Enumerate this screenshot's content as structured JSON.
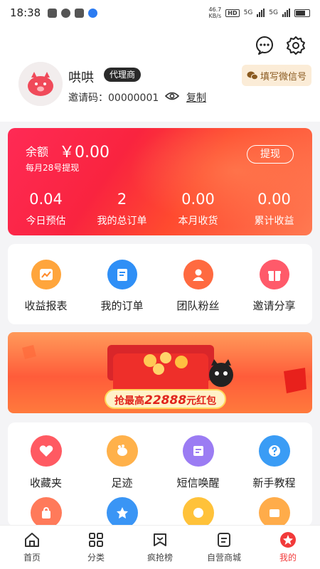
{
  "status_bar": {
    "time": "18:38",
    "speed_value": "46.7",
    "speed_unit": "KB/s",
    "hd": "HD",
    "net1": "5G",
    "net2": "5G"
  },
  "profile": {
    "username": "哄哄",
    "role": "代理商",
    "invite_label": "邀请码：00000001",
    "copy_label": "复制",
    "wechat_button": "填写微信号"
  },
  "balance": {
    "label": "余额",
    "amount": "￥0.00",
    "note": "每月28号提现",
    "withdraw_label": "提现",
    "stats": [
      {
        "value": "0.04",
        "label": "今日预估"
      },
      {
        "value": "2",
        "label": "我的总订单"
      },
      {
        "value": "0.00",
        "label": "本月收货"
      },
      {
        "value": "0.00",
        "label": "累计收益"
      }
    ]
  },
  "quick_actions": [
    {
      "label": "收益报表",
      "icon": "chart-report-icon",
      "color": "#ff9a3c"
    },
    {
      "label": "我的订单",
      "icon": "order-list-icon",
      "color": "#2f8ff6"
    },
    {
      "label": "团队粉丝",
      "icon": "team-user-icon",
      "color": "#ff6a40"
    },
    {
      "label": "邀请分享",
      "icon": "gift-icon",
      "color": "#ff5a6a"
    }
  ],
  "banner": {
    "prefix": "抢最高",
    "amount": "22888",
    "suffix": "元红包"
  },
  "tools": [
    {
      "label": "收藏夹",
      "icon": "heart-icon",
      "color": "#ff5a62"
    },
    {
      "label": "足迹",
      "icon": "footprint-icon",
      "color": "#ffb14a"
    },
    {
      "label": "短信唤醒",
      "icon": "sms-icon",
      "color": "#9b7cf3"
    },
    {
      "label": "新手教程",
      "icon": "help-icon",
      "color": "#3a9cf5"
    },
    {
      "label": "",
      "icon": "bag-icon",
      "color": "#ff7a5a"
    },
    {
      "label": "",
      "icon": "star-icon",
      "color": "#3a95f5"
    },
    {
      "label": "",
      "icon": "coin-icon",
      "color": "#ffc23a"
    },
    {
      "label": "",
      "icon": "ticket-icon",
      "color": "#ffac4a"
    }
  ],
  "tabbar": [
    {
      "label": "首页",
      "icon": "home-icon",
      "active": false
    },
    {
      "label": "分类",
      "icon": "grid-icon",
      "active": false
    },
    {
      "label": "疯抢榜",
      "icon": "bookmark-icon",
      "active": false
    },
    {
      "label": "自营商城",
      "icon": "document-icon",
      "active": false
    },
    {
      "label": "我的",
      "icon": "profile-star-icon",
      "active": true
    }
  ]
}
